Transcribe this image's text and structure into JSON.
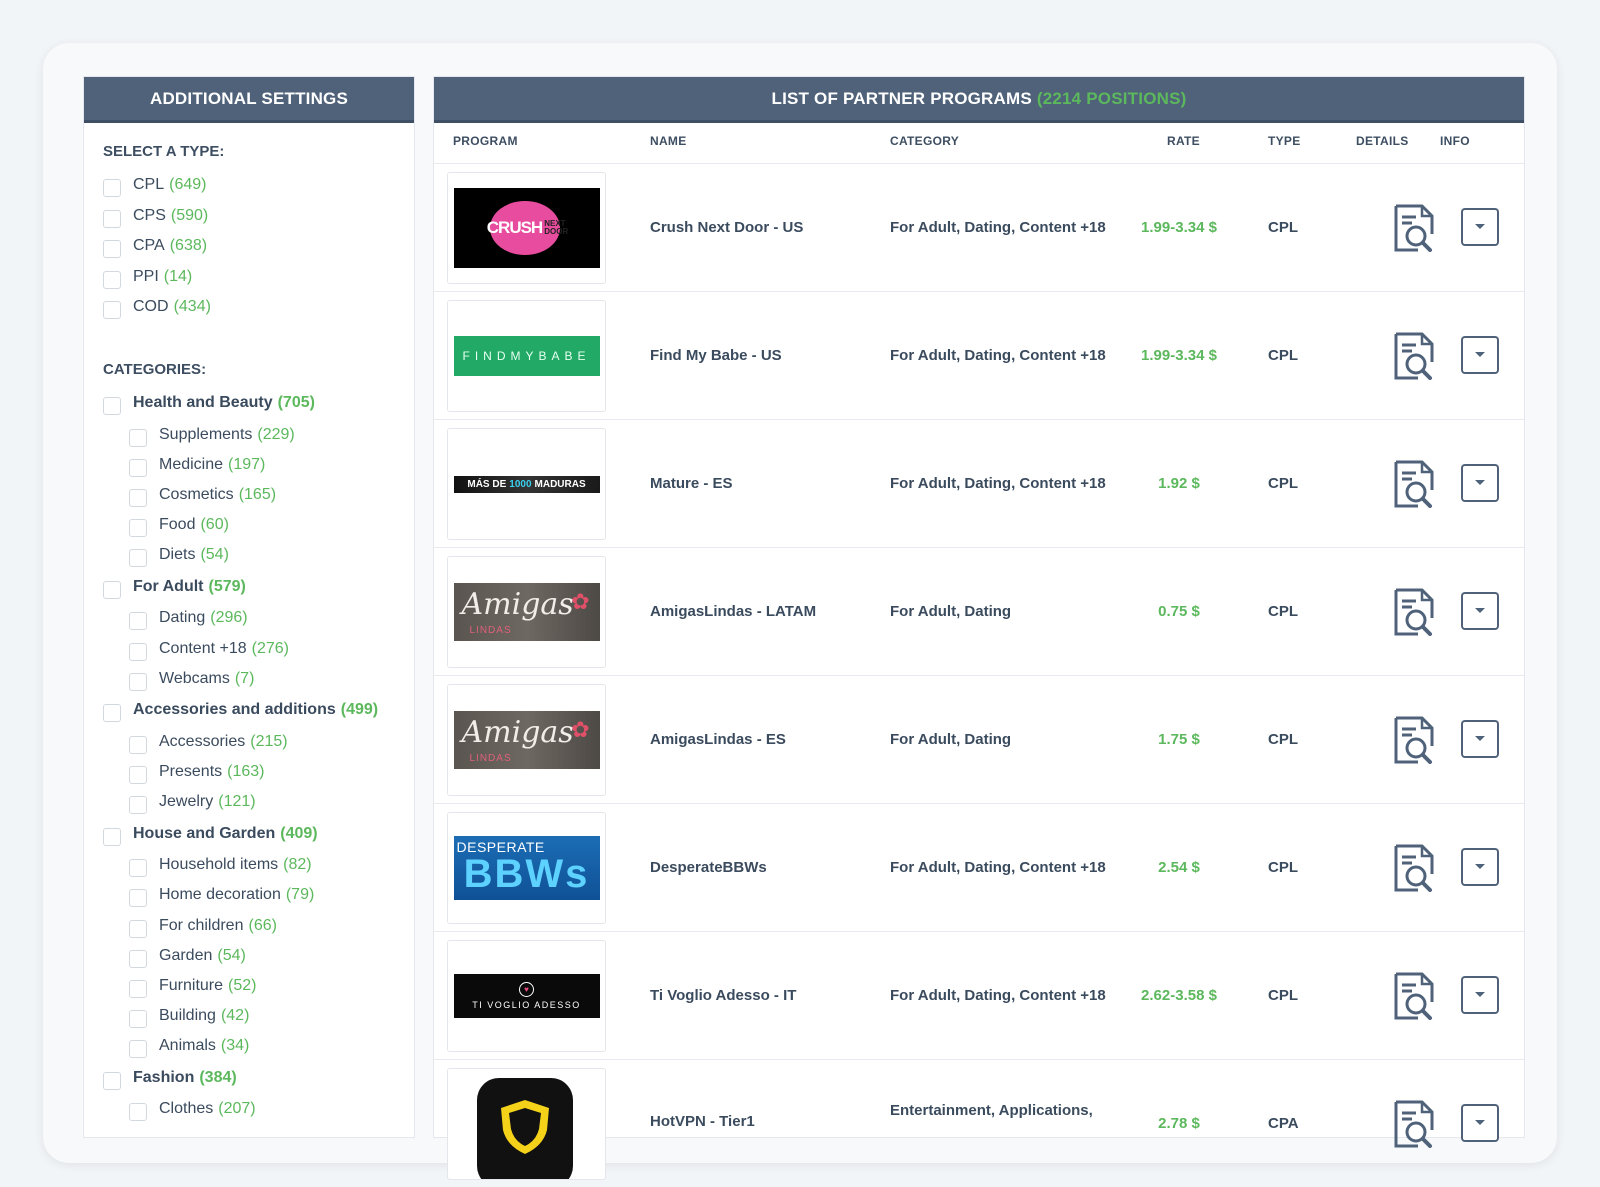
{
  "sidebar": {
    "title": "ADDITIONAL SETTINGS",
    "type_title": "SELECT A TYPE:",
    "types": [
      {
        "label": "CPL",
        "count": "(649)"
      },
      {
        "label": "CPS",
        "count": "(590)"
      },
      {
        "label": "CPA",
        "count": "(638)"
      },
      {
        "label": "PPI",
        "count": "(14)"
      },
      {
        "label": "COD",
        "count": "(434)"
      }
    ],
    "categories_title": "CATEGORIES:",
    "categories": [
      {
        "label": "Health and Beauty",
        "count": "(705)",
        "parent": true
      },
      {
        "label": "Supplements",
        "count": "(229)"
      },
      {
        "label": "Medicine",
        "count": "(197)"
      },
      {
        "label": "Cosmetics",
        "count": "(165)"
      },
      {
        "label": "Food",
        "count": "(60)"
      },
      {
        "label": "Diets",
        "count": "(54)"
      },
      {
        "label": "For Adult",
        "count": "(579)",
        "parent": true
      },
      {
        "label": "Dating",
        "count": "(296)"
      },
      {
        "label": "Content +18",
        "count": "(276)"
      },
      {
        "label": "Webcams",
        "count": "(7)"
      },
      {
        "label": "Accessories and additions",
        "count": "(499)",
        "parent": true
      },
      {
        "label": "Accessories",
        "count": "(215)"
      },
      {
        "label": "Presents",
        "count": "(163)"
      },
      {
        "label": "Jewelry",
        "count": "(121)"
      },
      {
        "label": "House and Garden",
        "count": "(409)",
        "parent": true
      },
      {
        "label": "Household items",
        "count": "(82)"
      },
      {
        "label": "Home decoration",
        "count": "(79)"
      },
      {
        "label": "For children",
        "count": "(66)"
      },
      {
        "label": "Garden",
        "count": "(54)"
      },
      {
        "label": "Furniture",
        "count": "(52)"
      },
      {
        "label": "Building",
        "count": "(42)"
      },
      {
        "label": "Animals",
        "count": "(34)"
      },
      {
        "label": "Fashion",
        "count": "(384)",
        "parent": true
      },
      {
        "label": "Clothes",
        "count": "(207)"
      }
    ]
  },
  "main": {
    "title": "LIST OF PARTNER PROGRAMS",
    "title_count": "(2214 POSITIONS)",
    "columns": {
      "program": "PROGRAM",
      "name": "NAME",
      "category": "CATEGORY",
      "rate": "RATE",
      "type": "TYPE",
      "details": "DETAILS",
      "info": "INFO"
    },
    "rows": [
      {
        "logo": "crush",
        "logo_text": "CRUSH",
        "logo_text2": "NEXT DOOR",
        "name": "Crush Next Door - US",
        "category": "For Adult, Dating, Content +18",
        "rate": "1.99-3.34 $",
        "type": "CPL"
      },
      {
        "logo": "findmybabe",
        "logo_text": "FINDMYBABE",
        "name": "Find My Babe - US",
        "category": "For Adult, Dating, Content +18",
        "rate": "1.99-3.34 $",
        "type": "CPL"
      },
      {
        "logo": "maduras",
        "logo_text": "MÁS DE",
        "logo_text2": "1000",
        "logo_text3": "MADURAS",
        "name": "Mature - ES",
        "category": "For Adult, Dating, Content +18",
        "rate": "1.92 $",
        "type": "CPL"
      },
      {
        "logo": "amigas",
        "logo_text": "Amigas",
        "logo_text2": "LINDAS",
        "name": "AmigasLindas - LATAM",
        "category": "For Adult, Dating",
        "rate": "0.75 $",
        "type": "CPL"
      },
      {
        "logo": "amigas",
        "logo_text": "Amigas",
        "logo_text2": "LINDAS",
        "name": "AmigasLindas - ES",
        "category": "For Adult, Dating",
        "rate": "1.75 $",
        "type": "CPL"
      },
      {
        "logo": "bbw",
        "logo_text": "DESPERATE",
        "logo_text2": "BBWs",
        "name": "DesperateBBWs",
        "category": "For Adult, Dating, Content +18",
        "rate": "2.54 $",
        "type": "CPL"
      },
      {
        "logo": "tivoglio",
        "logo_text": "TI VOGLIO ADESSO",
        "name": "Ti Voglio Adesso - IT",
        "category": "For Adult, Dating, Content +18",
        "rate": "2.62-3.58 $",
        "type": "CPL"
      },
      {
        "logo": "hotvpn",
        "logo_text": "",
        "name": "HotVPN - Tier1",
        "category": "Entertainment, Applications,",
        "rate": "2.78 $",
        "type": "CPA"
      }
    ]
  },
  "colors": {
    "header_bg": "#4f6279",
    "accent_green": "#5cb85c",
    "text": "#3b4b5e"
  },
  "icons": {
    "details": "document-search-icon",
    "info": "chevron-down-icon"
  }
}
